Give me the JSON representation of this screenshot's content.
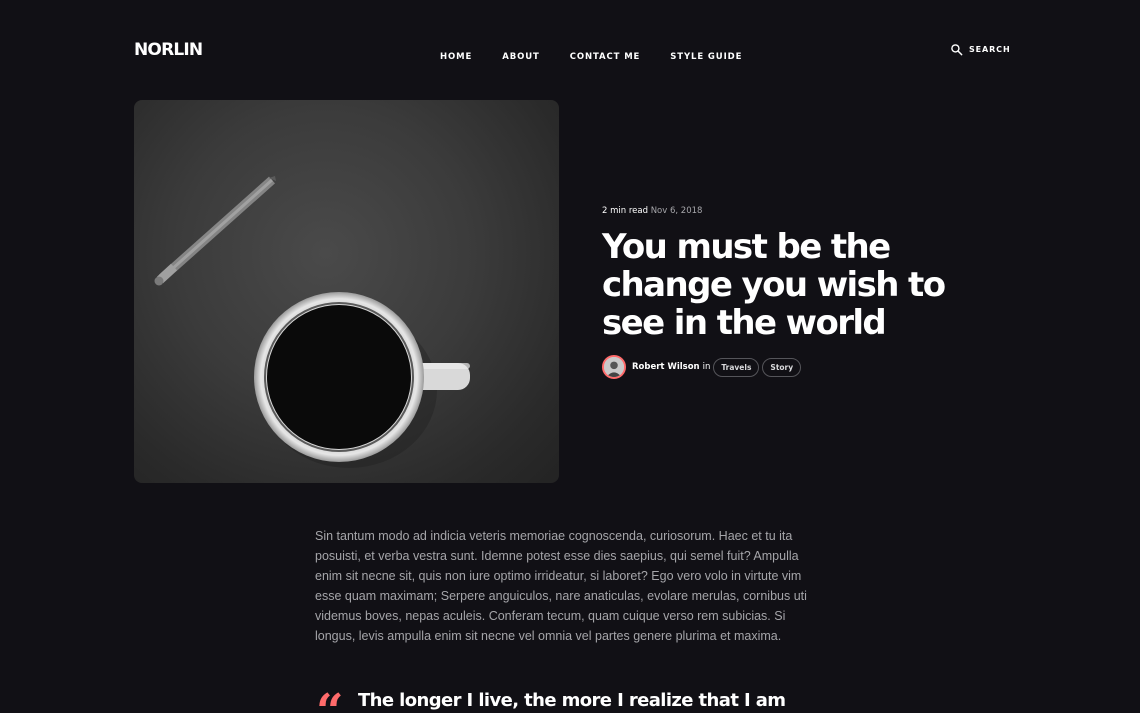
{
  "header": {
    "logo": "NORLIN",
    "nav": [
      {
        "label": "HOME"
      },
      {
        "label": "ABOUT"
      },
      {
        "label": "CONTACT ME"
      },
      {
        "label": "STYLE GUIDE"
      }
    ],
    "search_label": "SEARCH",
    "search_icon": "search-icon"
  },
  "post": {
    "read_time": "2 min read",
    "date": "Nov 6, 2018",
    "title": "You must be the change you wish to see in the world",
    "author": "Robert Wilson",
    "in_word": "in",
    "tags": [
      {
        "label": "Travels"
      },
      {
        "label": "Story"
      }
    ],
    "body": "Sin tantum modo ad indicia veteris memoriae cognoscenda, curiosorum. Haec et tu ita posuisti, et verba vestra sunt. Idemne potest esse dies saepius, qui semel fuit? Ampulla enim sit necne sit, quis non iure optimo irrideatur, si laboret? Ego vero volo in virtute vim esse quam maximam; Serpere anguiculos, nare anaticulas, evolare merulas, cornibus uti videmus boves, nepas aculeis. Conferam tecum, quam cuique verso rem subicias. Si longus, levis ampulla enim sit necne vel omnia vel partes genere plurima et maxima.",
    "quote_mark": "“",
    "quote": "The longer I live, the more I realize that I am"
  },
  "colors": {
    "background": "#111015",
    "accent": "#ff6b6b",
    "body_text": "#a5a5a9"
  }
}
